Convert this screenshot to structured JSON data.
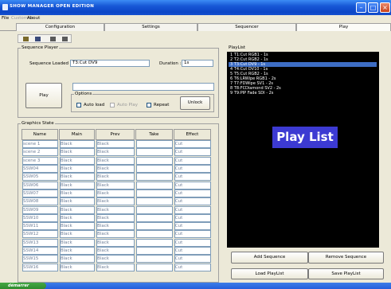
{
  "window": {
    "title": "SHOW MANAGER OPEN EDITION"
  },
  "menu": [
    {
      "label": "File"
    },
    {
      "label": "Customize"
    },
    {
      "label": "About"
    }
  ],
  "tabs": [
    {
      "label": "Configuration"
    },
    {
      "label": "Settings"
    },
    {
      "label": "Sequencer"
    },
    {
      "label": "Play"
    }
  ],
  "toolbar": {
    "icons": [
      "open-folder-icon",
      "save-icon",
      "copy-icon",
      "save-as-icon"
    ]
  },
  "sequence_player": {
    "title": "Sequence Player",
    "loaded_label": "Sequence Loaded :",
    "loaded_value": "T3:Cut DV9",
    "duration_label": "Duration :",
    "duration_value": "1s",
    "play_label": "Play",
    "options_label": "Options",
    "autoload_label": "Auto load",
    "autoplay_label": "Auto Play",
    "repeat_label": "Repeat",
    "unlock_label": "Unlock"
  },
  "graphics_state": {
    "title": "Graphics State",
    "columns": [
      "Name",
      "Main",
      "Prev",
      "Take",
      "Effect"
    ],
    "rows": [
      [
        "scene 1",
        "Black",
        "Black",
        "",
        "Cut"
      ],
      [
        "scene 2",
        "Black",
        "Black",
        "",
        "Cut"
      ],
      [
        "scene 3",
        "Black",
        "Black",
        "",
        "Cut"
      ],
      [
        "SSW04",
        "Black",
        "Black",
        "",
        "Cut"
      ],
      [
        "SSW05",
        "Black",
        "Black",
        "",
        "Cut"
      ],
      [
        "SSW06",
        "Black",
        "Black",
        "",
        "Cut"
      ],
      [
        "SSW07",
        "Black",
        "Black",
        "",
        "Cut"
      ],
      [
        "SSW08",
        "Black",
        "Black",
        "",
        "Cut"
      ],
      [
        "SSW09",
        "Black",
        "Black",
        "",
        "Cut"
      ],
      [
        "SSW10",
        "Black",
        "Black",
        "",
        "Cut"
      ],
      [
        "SSW11",
        "Black",
        "Black",
        "",
        "Cut"
      ],
      [
        "SSW12",
        "Black",
        "Black",
        "",
        "Cut"
      ],
      [
        "SSW13",
        "Black",
        "Black",
        "",
        "Cut"
      ],
      [
        "SSW14",
        "Black",
        "Black",
        "",
        "Cut"
      ],
      [
        "SSW15",
        "Black",
        "Black",
        "",
        "Cut"
      ],
      [
        "SSW16",
        "Black",
        "Black",
        "",
        "Cut"
      ]
    ]
  },
  "playlist": {
    "title": "PlayList",
    "items": [
      "1  T1:Cut RGB1  -  1s",
      "2  T2:Cut RGB2  -  1s",
      "3  T3:Cut DV9  -  1s",
      "4  T4:Cut DV10  -  1s",
      "5  T5:Cut RGB2  -  1s",
      "6  T6:LRWipe RGB1  -  2s",
      "7  T7:FDWipe SV1  -  2s",
      "8  T8:FCDiamond SV2  -  2s",
      "9  T9:PIP Fade SDI  -  2s"
    ],
    "selected_index": 2,
    "overlay_label": "Play List",
    "add_label": "Add Sequence",
    "remove_label": "Remove Sequence",
    "load_label": "Load PlayList",
    "save_label": "Save PlayList"
  },
  "taskbar": {
    "start_label": "démarrer"
  },
  "colors": {
    "titlebar": "#0c46c6",
    "playlist_bg": "#000000",
    "overlay": "#3c3ad2",
    "selection": "#3d6dc4"
  }
}
